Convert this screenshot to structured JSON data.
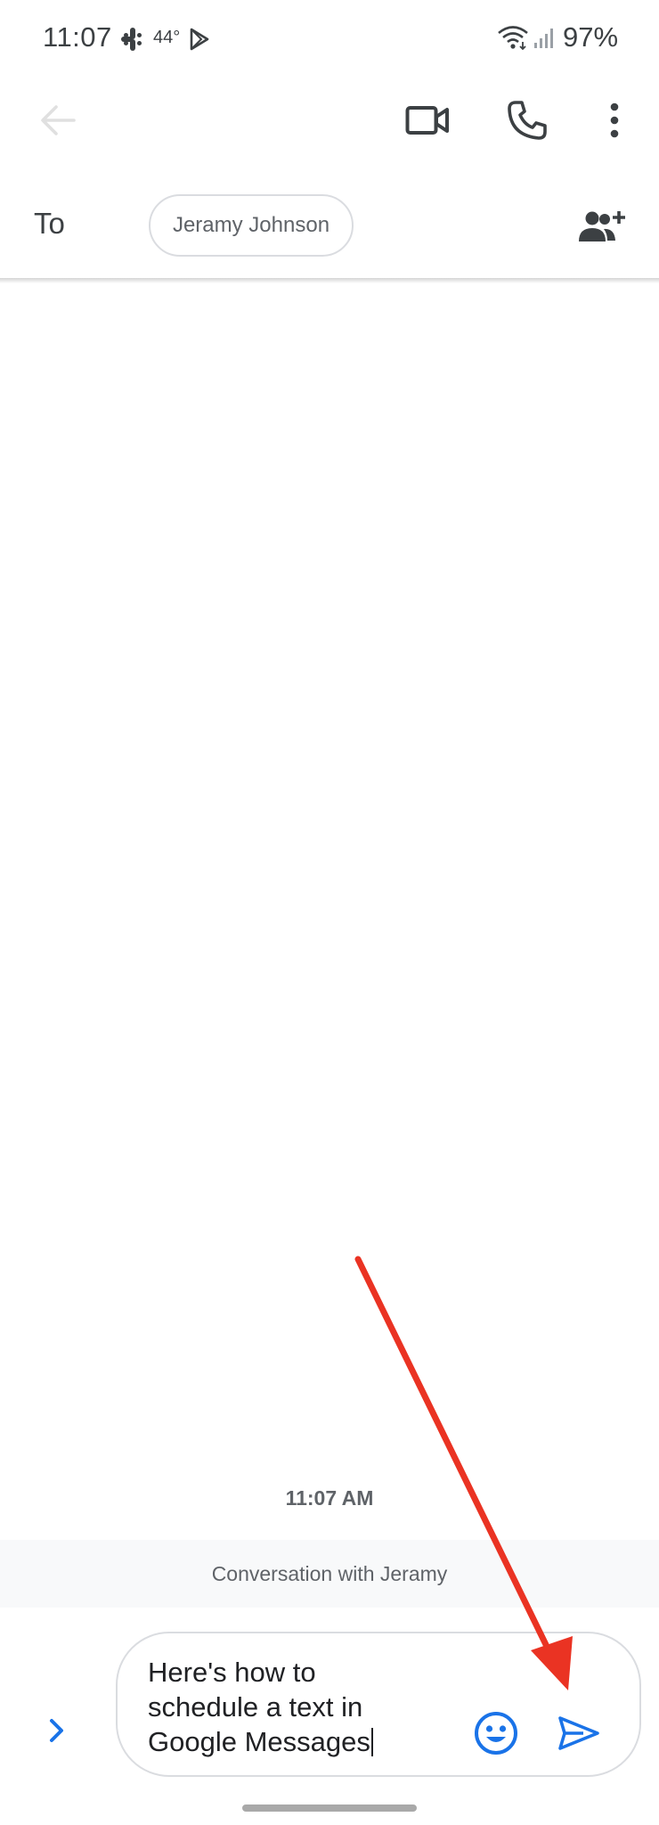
{
  "status_bar": {
    "time": "11:07",
    "temperature": "44°",
    "battery": "97%",
    "icons": [
      "slack-icon",
      "play-store-icon",
      "wifi-icon",
      "signal-icon"
    ]
  },
  "app_bar": {
    "icons": [
      "back-arrow-icon",
      "video-call-icon",
      "phone-icon",
      "more-vert-icon"
    ]
  },
  "recipients": {
    "to_label": "To",
    "chip": "Jeramy Johnson",
    "add_icon": "add-people-icon"
  },
  "conversation": {
    "timestamp": "11:07 AM",
    "banner": "Conversation with Jeramy"
  },
  "compose": {
    "text": "Here's how to\nschedule a text in\nGoogle Messages",
    "expand_icon": "chevron-right-icon",
    "emoji_icon": "emoji-icon",
    "send_icon": "send-icon"
  },
  "colors": {
    "accent_blue": "#1a73e8",
    "annotation_red": "#ea3323",
    "text": "#3c4043",
    "muted": "#5f6368",
    "border": "#dadce0"
  }
}
